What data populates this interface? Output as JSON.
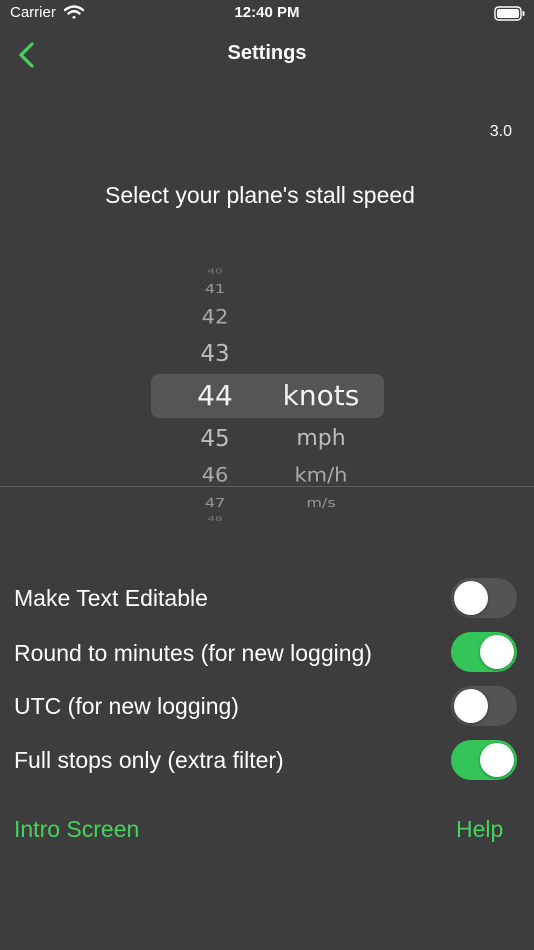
{
  "status_bar": {
    "carrier": "Carrier",
    "time": "12:40 PM"
  },
  "nav": {
    "title": "Settings",
    "back_icon": "chevron-left-icon"
  },
  "version": "3.0",
  "picker": {
    "title": "Select your plane's stall speed",
    "numbers": [
      "40",
      "41",
      "42",
      "43",
      "44",
      "45",
      "46",
      "47",
      "48"
    ],
    "selected_number": "44",
    "units": [
      "knots",
      "mph",
      "km/h",
      "m/s"
    ],
    "selected_unit": "knots"
  },
  "toggles": [
    {
      "label": "Make Text Editable",
      "on": false
    },
    {
      "label": "Round to minutes (for new logging)",
      "on": true
    },
    {
      "label": "UTC  (for new logging)",
      "on": false
    },
    {
      "label": "Full stops only  (extra filter)",
      "on": true
    }
  ],
  "links": {
    "intro": "Intro Screen",
    "help": "Help"
  },
  "colors": {
    "background": "#3d3d3d",
    "accent": "#45d25c",
    "toggle_on": "#35c457",
    "toggle_off": "#545454"
  }
}
